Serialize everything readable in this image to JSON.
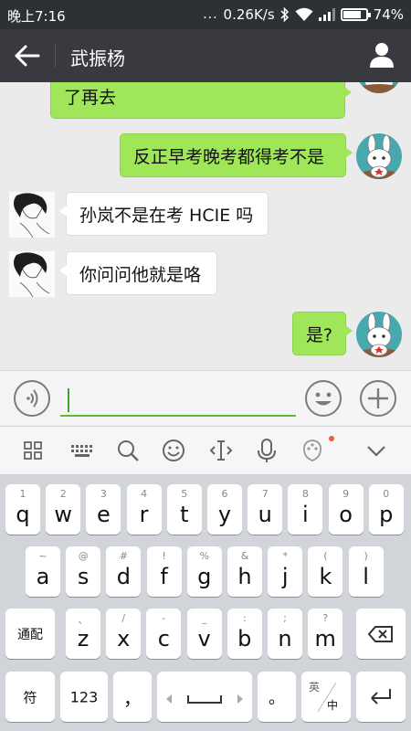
{
  "status": {
    "time": "晚上7:16",
    "dots": "...",
    "speed": "0.26K/s",
    "battery": "74%",
    "battery_level": 0.74
  },
  "header": {
    "title": "武振杨"
  },
  "messages": [
    {
      "side": "me",
      "text": "了再去"
    },
    {
      "side": "me",
      "text": "反正早考晚考都得考不是"
    },
    {
      "side": "them",
      "text": "孙岚不是在考 HCIE 吗"
    },
    {
      "side": "them",
      "text": "你问问他就是咯"
    },
    {
      "side": "me",
      "text": "是?"
    }
  ],
  "keyboard": {
    "row1": [
      {
        "sup": "1",
        "main": "q"
      },
      {
        "sup": "2",
        "main": "w"
      },
      {
        "sup": "3",
        "main": "e"
      },
      {
        "sup": "4",
        "main": "r"
      },
      {
        "sup": "5",
        "main": "t"
      },
      {
        "sup": "6",
        "main": "y"
      },
      {
        "sup": "7",
        "main": "u"
      },
      {
        "sup": "8",
        "main": "i"
      },
      {
        "sup": "9",
        "main": "o"
      },
      {
        "sup": "0",
        "main": "p"
      }
    ],
    "row2": [
      {
        "sup": "~",
        "main": "a"
      },
      {
        "sup": "@",
        "main": "s"
      },
      {
        "sup": "#",
        "main": "d"
      },
      {
        "sup": "!",
        "main": "f"
      },
      {
        "sup": "%",
        "main": "g"
      },
      {
        "sup": "&",
        "main": "h"
      },
      {
        "sup": "*",
        "main": "j"
      },
      {
        "sup": "(",
        "main": "k"
      },
      {
        "sup": ")",
        "main": "l"
      }
    ],
    "row3": [
      {
        "sup": "、",
        "main": "z"
      },
      {
        "sup": "/",
        "main": "x"
      },
      {
        "sup": "-",
        "main": "c"
      },
      {
        "sup": "_",
        "main": "v"
      },
      {
        "sup": ":",
        "main": "b"
      },
      {
        "sup": ";",
        "main": "n"
      },
      {
        "sup": "?",
        "main": "m"
      }
    ],
    "tongpei": "通配",
    "fu": "符",
    "num": "123",
    "comma": "，",
    "period": "。",
    "lang_en": "英",
    "lang_zh": "中"
  }
}
